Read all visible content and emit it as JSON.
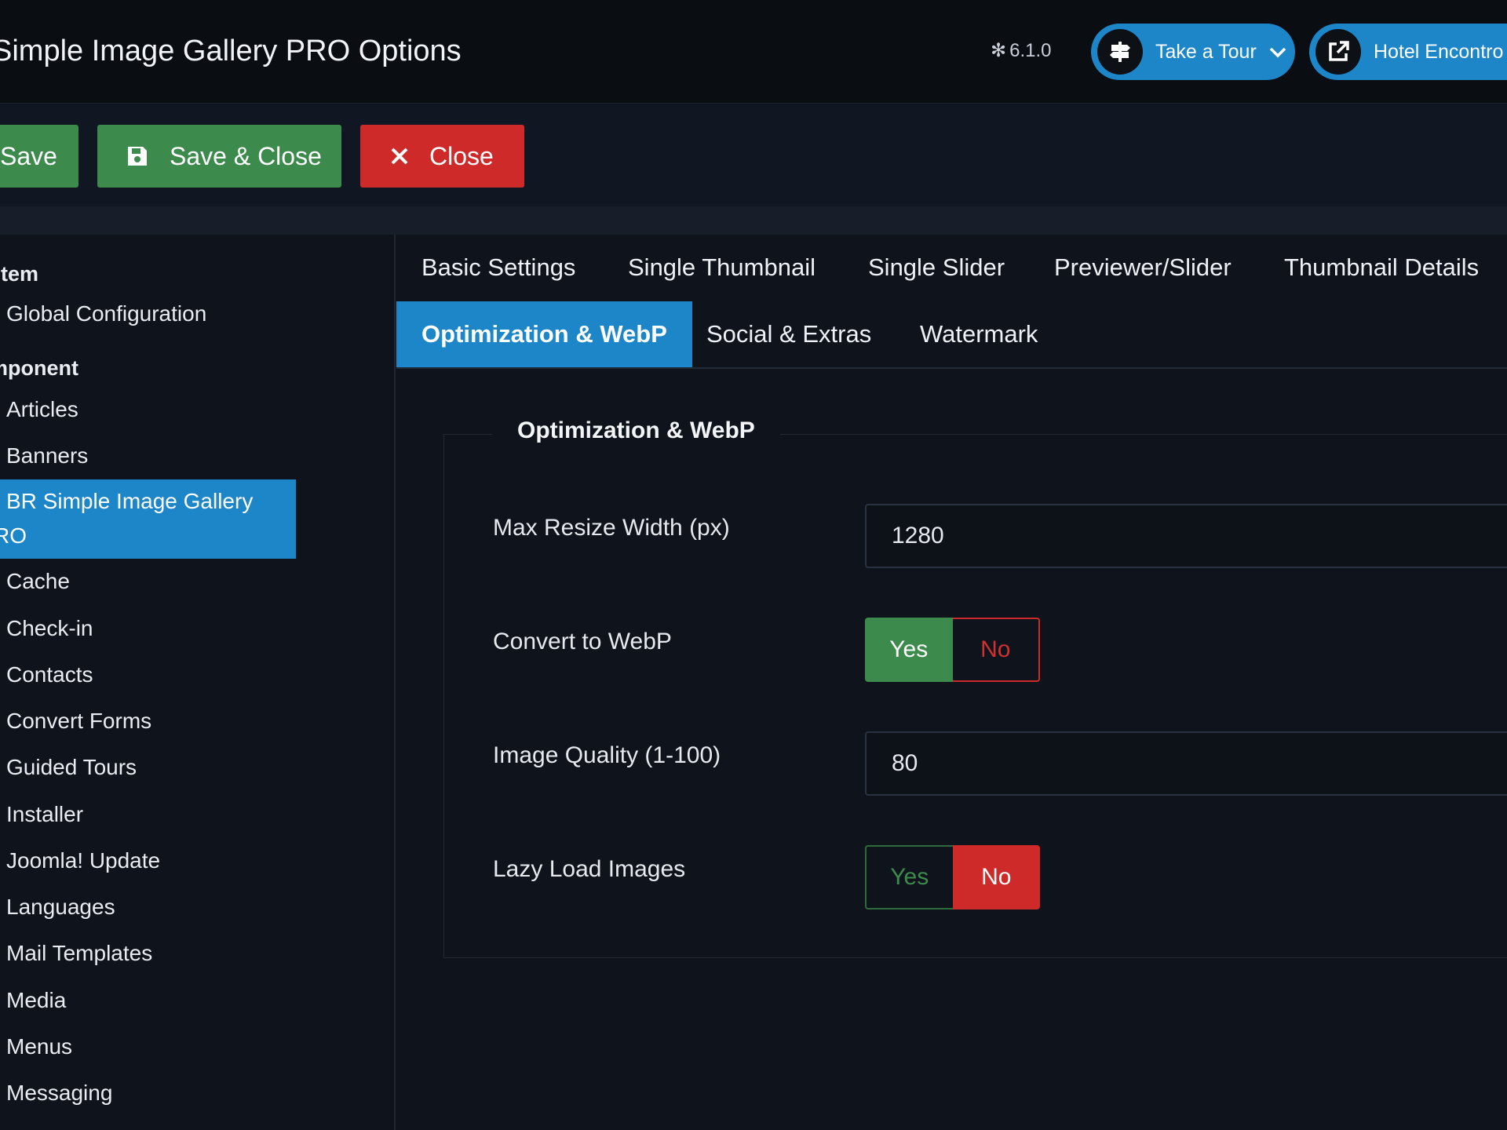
{
  "header": {
    "title": "Simple Image Gallery PRO Options",
    "version": "6.1.0",
    "version_icon": "joomla-icon",
    "tour_label": "Take a Tour",
    "site_label": "Hotel Encontro d"
  },
  "toolbar": {
    "save_label": "Save",
    "save_close_label": "Save & Close",
    "close_label": "Close"
  },
  "sidebar": {
    "system_heading": "stem",
    "global_config": "Global Configuration",
    "component_heading": "mponent",
    "items": [
      "Articles",
      "Banners",
      "Cache",
      "Check-in",
      "Contacts",
      "Convert Forms",
      "Guided Tours",
      "Installer",
      "Joomla! Update",
      "Languages",
      "Mail Templates",
      "Media",
      "Menus",
      "Messaging"
    ],
    "active_line1": "BR Simple Image Gallery",
    "active_line2": "RO"
  },
  "tabs": {
    "row1": [
      "Basic Settings",
      "Single Thumbnail",
      "Single Slider",
      "Previewer/Slider",
      "Thumbnail Details"
    ],
    "row2": [
      "Optimization & WebP",
      "Social & Extras",
      "Watermark"
    ],
    "active": "Optimization & WebP"
  },
  "form": {
    "legend": "Optimization & WebP",
    "max_width_label": "Max Resize Width (px)",
    "max_width_value": "1280",
    "webp_label": "Convert to WebP",
    "quality_label": "Image Quality (1-100)",
    "quality_value": "80",
    "lazy_label": "Lazy Load Images",
    "yes": "Yes",
    "no": "No",
    "webp_selected": "Yes",
    "lazy_selected": "No"
  },
  "colors": {
    "accent": "#1c86c8",
    "success": "#3d8a4d",
    "danger": "#cf2a2a",
    "background": "#0f141c"
  }
}
